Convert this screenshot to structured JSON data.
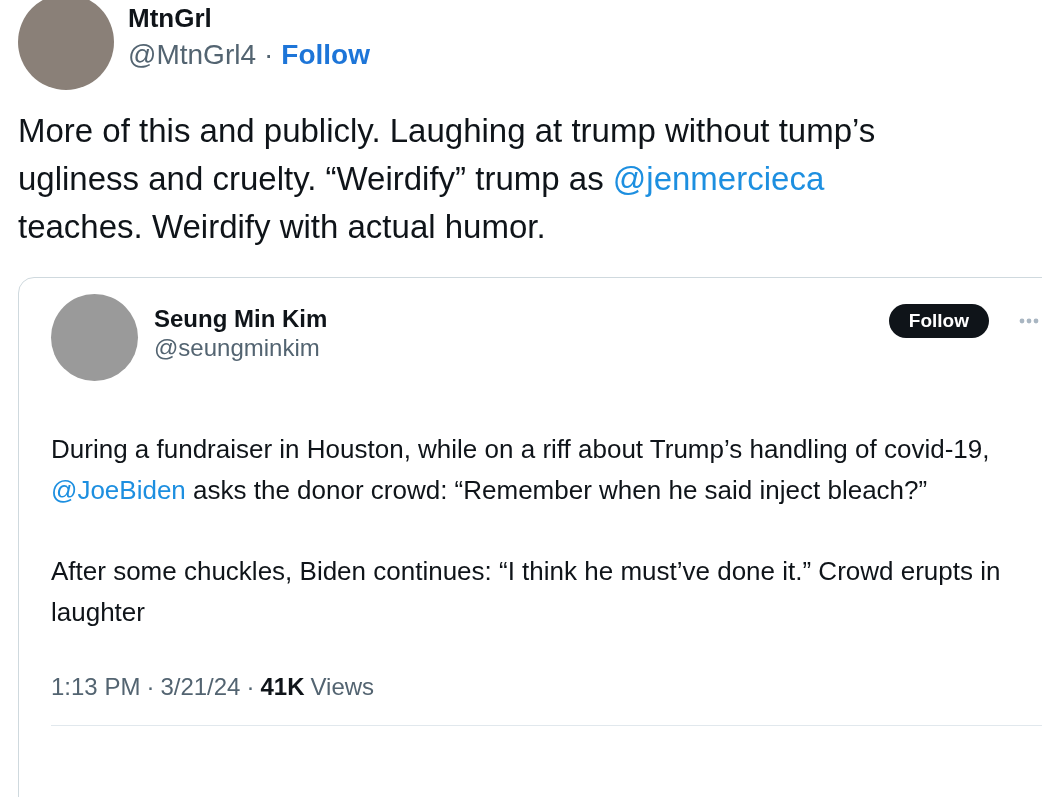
{
  "author": {
    "name": "MtnGrl",
    "handle": "@MtnGrl4",
    "separator": "·",
    "follow": "Follow"
  },
  "text": [
    {
      "kind": "plain",
      "text": "More of this and publicly. Laughing at trump without tump’s ugliness and cruelty. “Weirdify” trump as "
    },
    {
      "kind": "mention",
      "text": "@jenmercieca"
    },
    {
      "kind": "plain",
      "text": " teaches. Weirdify with actual humor."
    }
  ],
  "quoted": {
    "name": "Seung Min Kim",
    "handle": "@seungminkim",
    "follow": "Follow",
    "paragraphs": [
      [
        {
          "kind": "plain",
          "text": "During a fundraiser in Houston, while on a riff about Trump’s handling of covid-19, "
        },
        {
          "kind": "mention",
          "text": "@JoeBiden"
        },
        {
          "kind": "plain",
          "text": " asks the donor crowd: “Remember when he said inject bleach?”"
        }
      ],
      [
        {
          "kind": "plain",
          "text": "After some chuckles, Biden continues: “I think he must’ve done it.” Crowd erupts in laughter"
        }
      ]
    ],
    "time": "1:13 PM",
    "date": "3/21/24",
    "views_count": "41K",
    "views_label": "Views",
    "separator": "·"
  }
}
